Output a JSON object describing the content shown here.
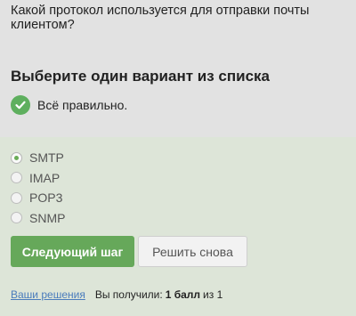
{
  "question": "Какой протокол используется для отправки почты клиентом?",
  "section_title": "Выберите один вариант из списка",
  "result": {
    "text": "Всё правильно.",
    "icon": "checkmark-icon",
    "color": "#5eaf5e"
  },
  "options": [
    {
      "label": "SMTP",
      "selected": true
    },
    {
      "label": "IMAP",
      "selected": false
    },
    {
      "label": "POP3",
      "selected": false
    },
    {
      "label": "SNMP",
      "selected": false
    }
  ],
  "buttons": {
    "next": "Следующий шаг",
    "retry": "Решить снова"
  },
  "footer": {
    "solutions_link": "Ваши решения",
    "score_label": "Вы получили:",
    "score_value": "1 балл",
    "score_suffix": "из 1"
  },
  "colors": {
    "accent": "#66a85a",
    "answer_bg": "#dde5d8",
    "page_bg": "#e2e2e2",
    "link": "#4a7cbc"
  }
}
